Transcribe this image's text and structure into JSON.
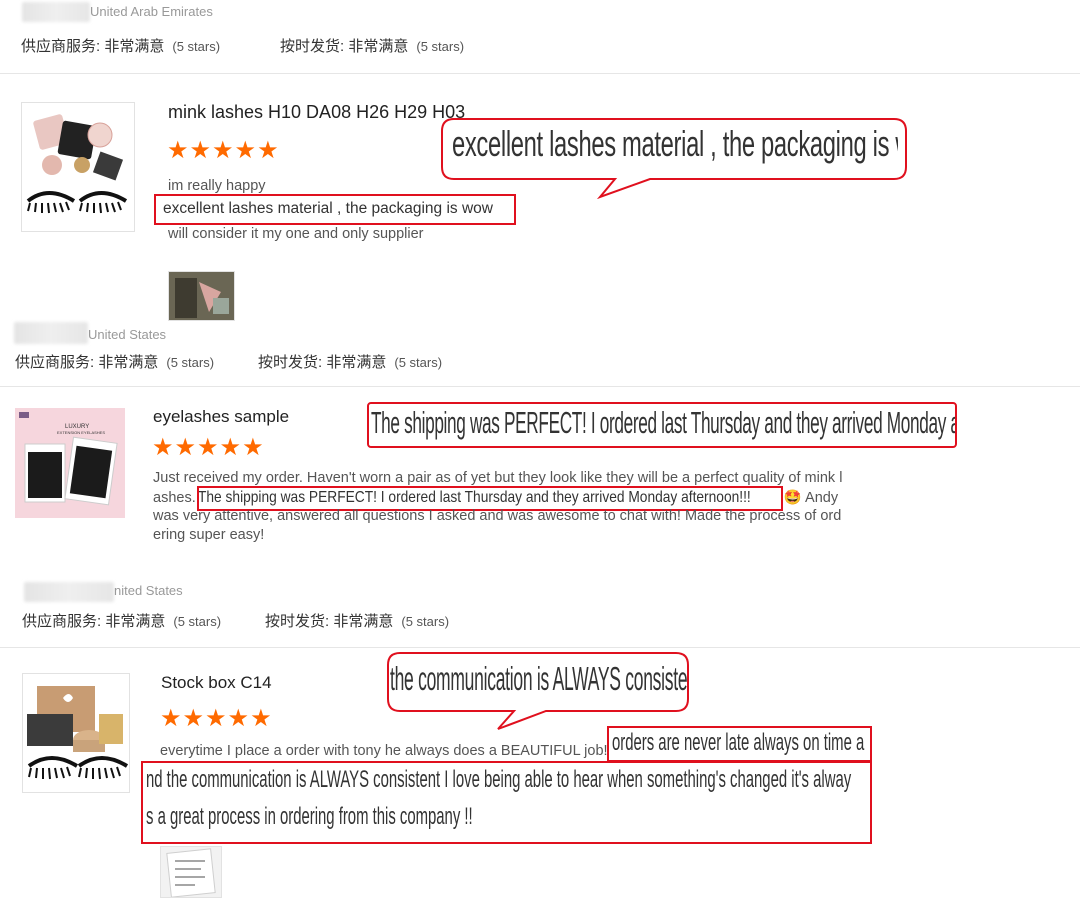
{
  "reviews": [
    {
      "location": "United Arab Emirates",
      "supplier_label": "供应商服务:",
      "supplier_value": "非常满意",
      "supplier_stars": "(5 stars)",
      "shipping_label": "按时发货:",
      "shipping_value": "非常满意",
      "shipping_stars": "(5 stars)",
      "product": "mink lashes H10 DA08 H26 H29 H03",
      "stars": "★★★★★",
      "lines": [
        "im really happy",
        "excellent lashes material , the packaging is wow",
        "will consider it my one and only supplier"
      ],
      "callout": "excellent lashes material , the packaging is wow"
    },
    {
      "location": "United States",
      "supplier_label": "供应商服务:",
      "supplier_value": "非常满意",
      "supplier_stars": "(5 stars)",
      "shipping_label": "按时发货:",
      "shipping_value": "非常满意",
      "shipping_stars": "(5 stars)",
      "product": "eyelashes sample",
      "stars": "★★★★★",
      "line1": "Just received my order. Haven't worn a pair as of yet but they look like they will be a perfect quality of mink l",
      "line2_pre": "ashes.",
      "line2_hl": "The shipping was PERFECT! I ordered last Thursday and they arrived Monday afternoon!!!",
      "line2_post": "🤩 Andy",
      "line3": "was very attentive, answered all questions I asked and was awesome to chat with! Made the process of ord",
      "line4": "ering super easy!",
      "callout": "The shipping was PERFECT! I ordered last Thursday and they arrived Monday afternoon!!!"
    },
    {
      "location": "nited States",
      "supplier_label": "供应商服务:",
      "supplier_value": "非常满意",
      "supplier_stars": "(5 stars)",
      "shipping_label": "按时发货:",
      "shipping_value": "非常满意",
      "shipping_stars": "(5 stars)",
      "product": "Stock box C14",
      "stars": "★★★★★",
      "line1": "everytime I place a order with tony he always does a BEAUTIFUL job!",
      "hl_line1": "orders are never late always on time a",
      "hl_line2": "nd the communication is ALWAYS consistent I love being able to hear when something's changed it's alway",
      "hl_line3": "s a great process in ordering from this company !!",
      "callout": "the communication is ALWAYS consistent"
    }
  ],
  "product_images": {
    "r1_alt": "mink lashes product photo",
    "r2_brand": "LUXURY",
    "r2_sub": "EXTENSION EYELASHES",
    "r3_alt": "stock box product photo"
  }
}
